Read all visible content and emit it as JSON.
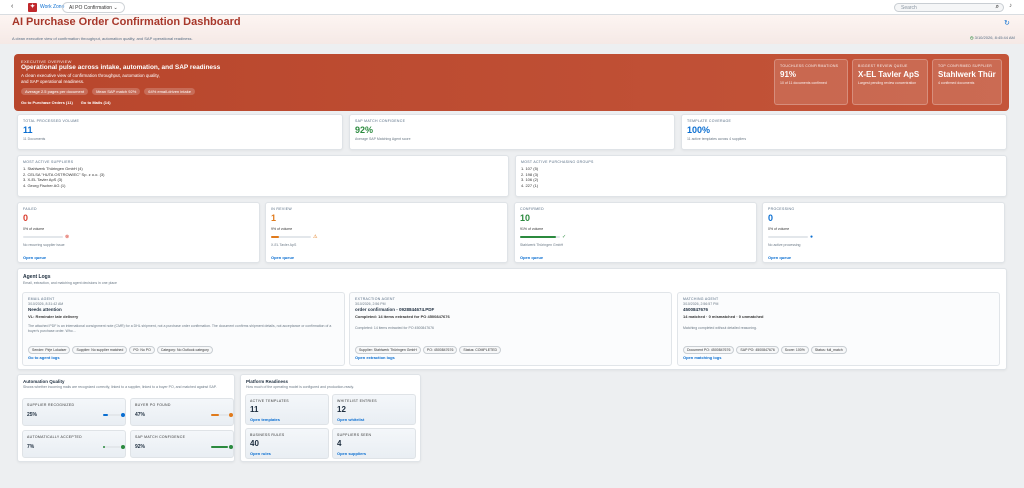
{
  "shell": {
    "workspace": "Work Zone",
    "app_menu": "AI PO Confirmation",
    "search_placeholder": "Search"
  },
  "page": {
    "title": "AI Purchase Order Confirmation Dashboard",
    "subtitle": "A clean executive view of confirmation throughput, automation quality, and SAP operational readiness.",
    "timestamp": "3/10/2026, 8:45:44 AM"
  },
  "hero": {
    "eyebrow": "EXECUTIVE OVERVIEW",
    "heading": "Operational pulse across intake, automation, and SAP readiness",
    "paragraph": "A clean executive view of confirmation throughput, automation quality, and SAP operational readiness.",
    "chips": [
      "Average 2.5 pages per document",
      "Mean SAP match 92%",
      "64% email-driven intake"
    ],
    "links": [
      "Go to Purchase Orders (11)",
      "Go to Mails (14)"
    ],
    "cards": [
      {
        "label": "TOUCHLESS CONFIRMATIONS",
        "value": "91%",
        "sub": "10 of 11 documents confirmed"
      },
      {
        "label": "BIGGEST REVIEW QUEUE",
        "value": "X-EL Tavler ApS",
        "sub": "Largest pending review concentration"
      },
      {
        "label": "TOP CONFIRMED SUPPLIER",
        "value": "Stahlwerk Thüringen …",
        "sub": "4 confirmed documents"
      }
    ]
  },
  "kpis": [
    {
      "label": "TOTAL PROCESSED VOLUME",
      "value": "11",
      "sub": "11 Documents"
    },
    {
      "label": "SAP MATCH CONFIDENCE",
      "value": "92%",
      "sub": "Average SAP Matching Agent score"
    },
    {
      "label": "TEMPLATE COVERAGE",
      "value": "100%",
      "sub": "11 active templates across 4 suppliers"
    }
  ],
  "active_suppliers": {
    "label": "MOST ACTIVE SUPPLIERS",
    "items": [
      "1. Stahlwerk Thüringen GmbH (4)",
      "2. CELSA \"HUTA OSTROWIEC\" Sp. z o.o. (3)",
      "3. X-EL Tavler ApS (3)",
      "4. Georg Fischer AG (1)"
    ]
  },
  "purchasing_groups": {
    "label": "MOST ACTIVE PURCHASING GROUPS",
    "items": [
      "1. 107 (5)",
      "2. 198 (3)",
      "3. 106 (2)",
      "4. 227 (1)"
    ]
  },
  "status": [
    {
      "label": "FAILED",
      "value": "0",
      "pct": "0% of volume",
      "sub": "No recurring supplier issue",
      "link": "Open queue",
      "color": "#d93a2b",
      "level": 0
    },
    {
      "label": "IN REVIEW",
      "value": "1",
      "pct": "9% of volume",
      "sub": "X-EL Tavler ApS",
      "link": "Open queue",
      "color": "#e07a1b",
      "level": 0.09
    },
    {
      "label": "CONFIRMED",
      "value": "10",
      "pct": "91% of volume",
      "sub": "Stahlwerk Thüringen GmbH",
      "link": "Open queue",
      "color": "#2b8a3e",
      "level": 0.91
    },
    {
      "label": "PROCESSING",
      "value": "0",
      "pct": "0% of volume",
      "sub": "No active processing",
      "link": "Open queue",
      "color": "#0a6ed1",
      "level": 0
    }
  ],
  "agent_logs": {
    "title": "Agent Logs",
    "subtitle": "Email, extraction, and matching agent decisions in one place",
    "cards": [
      {
        "label": "EMAIL AGENT",
        "date": "3/10/2026, 8:31:42 AM",
        "title": "Needs attention",
        "sub": "VL: Reminder late delivery",
        "body": "The attached PDF is an international consignment note (CMR) for a DHL shipment, not a purchase order confirmation. The document confirms shipment details, not acceptance or confirmation of a buyer's purchase order. Who…",
        "pills": [
          "Sender: Pirje Lokaiser",
          "Supplier: No supplier matched",
          "PO: No PO",
          "Category: No Outlook category"
        ],
        "link": "Go to agent logs"
      },
      {
        "label": "EXTRACTION AGENT",
        "date": "3/10/2026, 2:56 PM",
        "title": "order confirmation - 0928844674.PDF",
        "sub": "Completed: 14 items extracted for PO 4500847676",
        "body": "Completed: 14 items extracted for PO 4500847676",
        "pills": [
          "Supplier: Stahlwerk Thüringen GmbH",
          "PO: 4500847676",
          "Status: COMPLETED"
        ],
        "link": "Open extraction logs"
      },
      {
        "label": "MATCHING AGENT",
        "date": "3/10/2026, 2:56:57 PM",
        "title": "4500847676",
        "sub": "14 matched · 0 mismatched · 0 unmatched",
        "body": "Matching completed without detailed reasoning.",
        "pills": [
          "Document PO: 4500847676",
          "SAP PO: 4500847676",
          "Score: 100%",
          "Status: full_match"
        ],
        "link": "Open matching logs"
      }
    ]
  },
  "automation": {
    "title": "Automation Quality",
    "subtitle": "Shows whether incoming mails are recognized correctly, linked to a supplier, linked to a buyer PO, and matched against SAP.",
    "tiles": [
      {
        "label": "SUPPLIER RECOGNIZED",
        "value": "25%",
        "color": "#0a6ed1",
        "level": 0.25
      },
      {
        "label": "BUYER PO FOUND",
        "value": "47%",
        "color": "#e07a1b",
        "level": 0.47
      },
      {
        "label": "AUTOMATICALLY ACCEPTED",
        "value": "7%",
        "color": "#2b8a3e",
        "level": 0.07
      },
      {
        "label": "SAP MATCH CONFIDENCE",
        "value": "92%",
        "color": "#2b8a3e",
        "level": 0.92
      }
    ]
  },
  "platform": {
    "title": "Platform Readiness",
    "subtitle": "How much of the operating model is configured and production-ready.",
    "tiles": [
      {
        "label": "ACTIVE TEMPLATES",
        "value": "11",
        "link": "Open templates"
      },
      {
        "label": "WHITELIST ENTRIES",
        "value": "12",
        "link": "Open whitelist"
      },
      {
        "label": "BUSINESS RULES",
        "value": "40",
        "link": "Open rules"
      },
      {
        "label": "SUPPLIERS SEEN",
        "value": "4",
        "link": "Open suppliers"
      }
    ]
  }
}
